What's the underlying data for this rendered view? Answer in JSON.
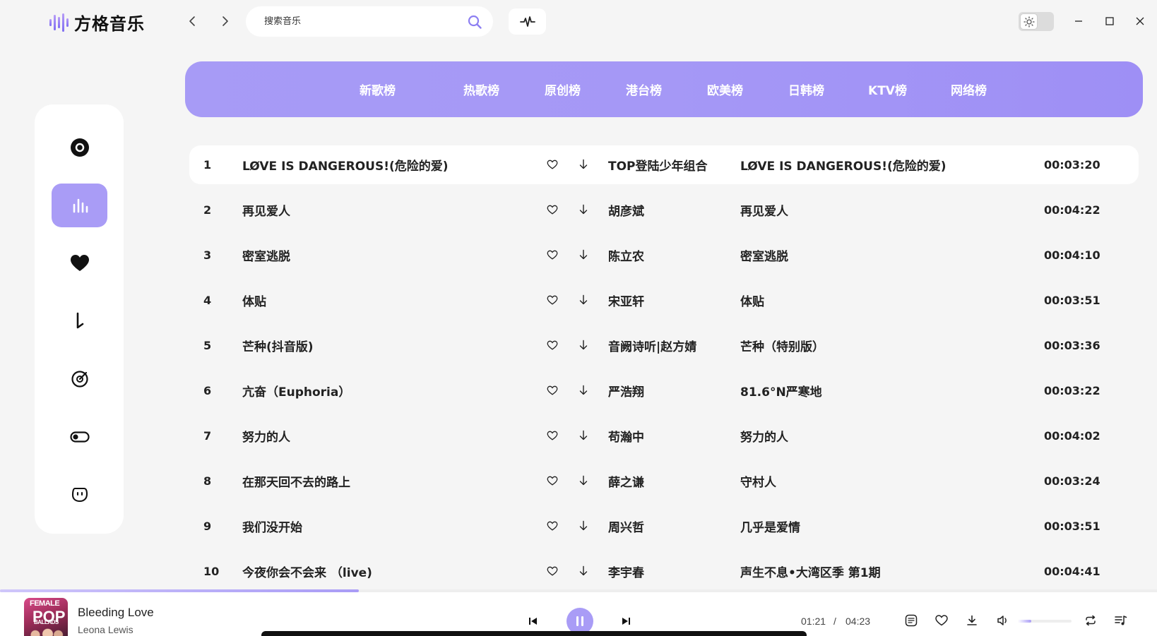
{
  "app": {
    "name": "方格音乐"
  },
  "search": {
    "placeholder": "搜索音乐",
    "value": ""
  },
  "colors": {
    "accent": "#a99cf6",
    "background": "#f5f5f5",
    "panel": "#ffffff"
  },
  "sidebar": {
    "items": [
      {
        "icon": "disc-icon",
        "active": false
      },
      {
        "icon": "chart-bars-icon",
        "active": true
      },
      {
        "icon": "heart-icon",
        "active": false
      },
      {
        "icon": "download-icon",
        "active": false
      },
      {
        "icon": "radar-icon",
        "active": false
      },
      {
        "icon": "toggle-icon",
        "active": false
      },
      {
        "icon": "face-icon",
        "active": false
      }
    ]
  },
  "tabs": [
    {
      "label": "新歌榜"
    },
    {
      "label": "热歌榜"
    },
    {
      "label": "原创榜"
    },
    {
      "label": "港台榜"
    },
    {
      "label": "欧美榜"
    },
    {
      "label": "日韩榜"
    },
    {
      "label": "KTV榜"
    },
    {
      "label": "网络榜"
    }
  ],
  "songs": [
    {
      "index": "1",
      "title": "LØVE IS DANGEROUS!(危险的爱)",
      "artist": "TOP登陆少年组合",
      "album": "LØVE IS DANGEROUS!(危险的爱)",
      "duration": "00:03:20"
    },
    {
      "index": "2",
      "title": "再见爱人",
      "artist": "胡彦斌",
      "album": "再见爱人",
      "duration": "00:04:22"
    },
    {
      "index": "3",
      "title": "密室逃脱",
      "artist": "陈立农",
      "album": "密室逃脱",
      "duration": "00:04:10"
    },
    {
      "index": "4",
      "title": "体贴",
      "artist": "宋亚轩",
      "album": "体贴",
      "duration": "00:03:51"
    },
    {
      "index": "5",
      "title": "芒种(抖音版)",
      "artist": "音阙诗听|赵方婧",
      "album": "芒种（特别版）",
      "duration": "00:03:36"
    },
    {
      "index": "6",
      "title": "亢奋（Euphoria）",
      "artist": "严浩翔",
      "album": "81.6°N严寒地",
      "duration": "00:03:22"
    },
    {
      "index": "7",
      "title": "努力的人",
      "artist": "苟瀚中",
      "album": "努力的人",
      "duration": "00:04:02"
    },
    {
      "index": "8",
      "title": "在那天回不去的路上",
      "artist": "薛之谦",
      "album": "守村人",
      "duration": "00:03:24"
    },
    {
      "index": "9",
      "title": "我们没开始",
      "artist": "周兴哲",
      "album": "几乎是爱情",
      "duration": "00:03:51"
    },
    {
      "index": "10",
      "title": "今夜你会不会来 （live)",
      "artist": "李宇春",
      "album": "声生不息•大湾区季 第1期",
      "duration": "00:04:41"
    }
  ],
  "active_song_index": 0,
  "player": {
    "title": "Bleeding Love",
    "artist": "Leona Lewis",
    "cover_text_top": "FEMALE",
    "cover_text_main": "POP",
    "cover_text_sub": "BALLADS",
    "current_time": "01:21",
    "separator": "/",
    "total_time": "04:23",
    "progress": 0.31,
    "volume": 0.25,
    "state": "playing"
  }
}
